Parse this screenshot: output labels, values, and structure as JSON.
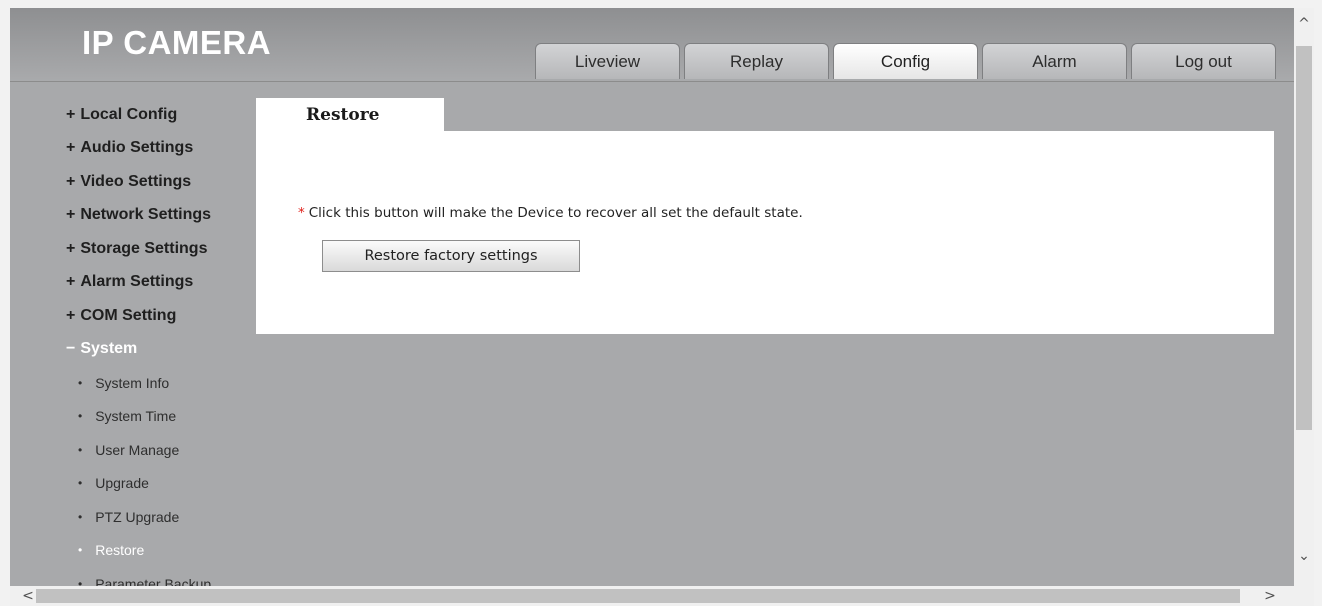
{
  "header": {
    "brand": "IP CAMERA",
    "tabs": [
      {
        "label": "Liveview",
        "active": false
      },
      {
        "label": "Replay",
        "active": false
      },
      {
        "label": "Config",
        "active": true
      },
      {
        "label": "Alarm",
        "active": false
      },
      {
        "label": "Log out",
        "active": false
      }
    ]
  },
  "sidebar": {
    "groups": [
      {
        "sign": "+",
        "label": "Local Config"
      },
      {
        "sign": "+",
        "label": "Audio Settings"
      },
      {
        "sign": "+",
        "label": "Video Settings"
      },
      {
        "sign": "+",
        "label": "Network Settings"
      },
      {
        "sign": "+",
        "label": "Storage Settings"
      },
      {
        "sign": "+",
        "label": "Alarm Settings"
      },
      {
        "sign": "+",
        "label": "COM Setting"
      },
      {
        "sign": "−",
        "label": "System"
      }
    ],
    "bullet": "•",
    "system_items": [
      {
        "label": "System Info"
      },
      {
        "label": "System Time"
      },
      {
        "label": "User Manage"
      },
      {
        "label": "Upgrade"
      },
      {
        "label": "PTZ Upgrade"
      },
      {
        "label": "Restore",
        "active": true
      },
      {
        "label": "Parameter Backup"
      }
    ]
  },
  "panel": {
    "tab_label": "Restore",
    "note_marker": "*",
    "note": "Click this button will make the Device to recover all set the default state.",
    "button_label": "Restore factory settings"
  },
  "scrollbars": {
    "up_icon": "^",
    "down_icon": "⌄",
    "left_icon": "<",
    "right_icon": ">"
  },
  "colors": {
    "background": "#a8a9ab",
    "active_text": "#ffffff",
    "note_marker": "#e0201a"
  }
}
